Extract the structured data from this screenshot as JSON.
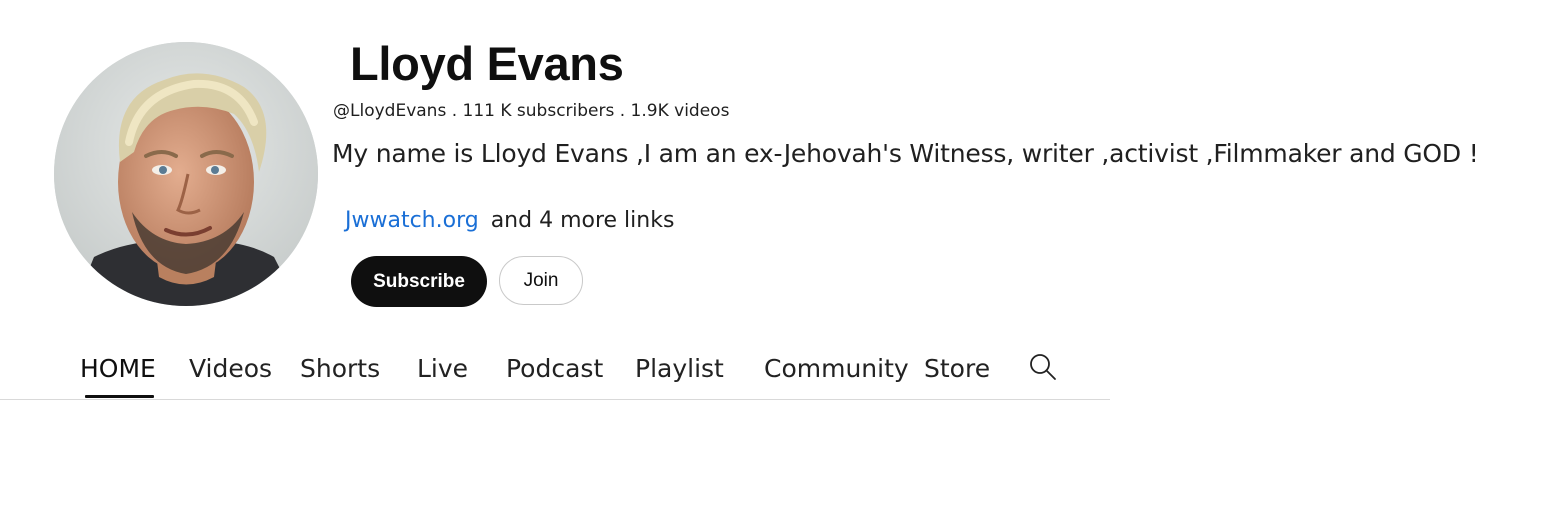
{
  "channel": {
    "name": "Lloyd Evans",
    "meta": "@LloydEvans . 111 K subscribers . 1.9K videos",
    "description": "My name is Lloyd Evans ,I am an ex-Jehovah's Witness, writer ,activist ,Filmmaker and GOD !",
    "link_text": "Jwwatch.org",
    "more_links_text": "and 4 more links"
  },
  "buttons": {
    "subscribe_label": "Subscribe",
    "join_label": "Join"
  },
  "tabs": [
    {
      "label": "HOME",
      "active": true
    },
    {
      "label": "Videos"
    },
    {
      "label": "Shorts"
    },
    {
      "label": "Live"
    },
    {
      "label": "Podcast"
    },
    {
      "label": "Playlist"
    },
    {
      "label": "Community"
    },
    {
      "label": "Store"
    }
  ],
  "icons": {
    "search": "search-icon",
    "avatar": "avatar"
  },
  "colors": {
    "link": "#1a6fd6",
    "subscribe_bg": "#0f0f0f",
    "text": "#0f0f0f"
  }
}
